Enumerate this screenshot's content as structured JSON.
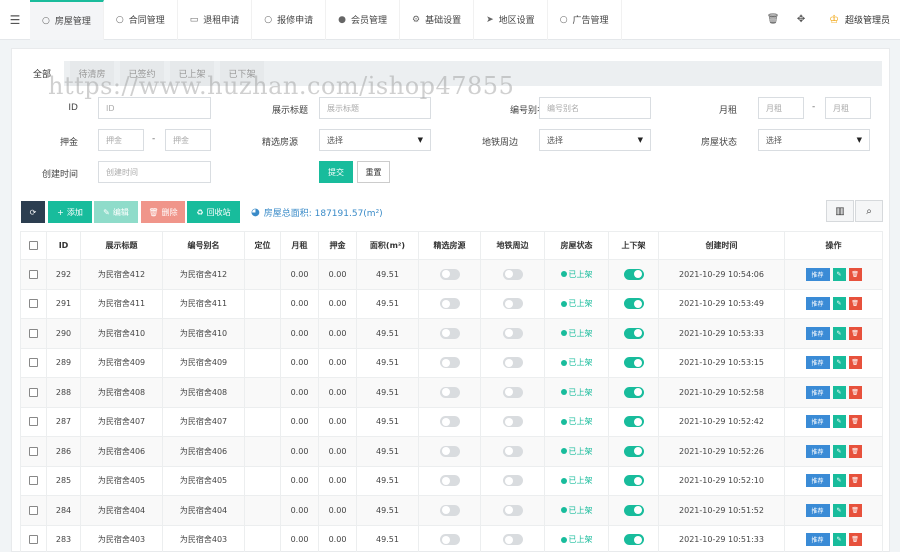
{
  "nav": {
    "menu_icon": "hamburger-icon",
    "tabs": [
      {
        "label": "房屋管理",
        "icon": "circle-icon",
        "active": true
      },
      {
        "label": "合同管理",
        "icon": "circle-icon"
      },
      {
        "label": "退租申请",
        "icon": "credit-card-icon"
      },
      {
        "label": "报修申请",
        "icon": "circle-icon"
      },
      {
        "label": "会员管理",
        "icon": "user-icon"
      },
      {
        "label": "基础设置",
        "icon": "gear-icon"
      },
      {
        "label": "地区设置",
        "icon": "send-icon"
      },
      {
        "label": "广告管理",
        "icon": "circle-icon"
      }
    ],
    "admin_name": "超级管理员"
  },
  "subtabs": [
    "全部",
    "待清房",
    "已签约",
    "已上架",
    "已下架"
  ],
  "form": {
    "id_label": "ID",
    "id_placeholder": "ID",
    "title_label": "展示标题",
    "title_placeholder": "展示标题",
    "alias_label": "编号别名",
    "alias_placeholder": "编号别名",
    "rent_label": "月租",
    "rent_min_placeholder": "月租",
    "rent_max_placeholder": "月租",
    "deposit_label": "押金",
    "deposit_min_placeholder": "押金",
    "deposit_max_placeholder": "押金",
    "featured_label": "精选房源",
    "featured_value": "选择",
    "subway_label": "地铁周边",
    "subway_value": "选择",
    "status_label": "房屋状态",
    "status_value": "选择",
    "created_label": "创建时间",
    "created_placeholder": "创建时间",
    "range_dash": "-",
    "submit": "提交",
    "reset": "重置"
  },
  "toolbar": {
    "add": "添加",
    "edit": "编辑",
    "delete": "删除",
    "recycle": "回收站",
    "area_text": "房屋总面积: 187191.57(m²)"
  },
  "table": {
    "headers": [
      "ID",
      "展示标题",
      "编号别名",
      "定位",
      "月租",
      "押金",
      "面积(m²)",
      "精选房源",
      "地铁周边",
      "房屋状态",
      "上下架",
      "创建时间",
      "操作"
    ],
    "rows": [
      {
        "id": "292",
        "title": "为民宿舍412",
        "alias": "为民宿舍412",
        "loc": "",
        "rent": "0.00",
        "deposit": "0.00",
        "area": "49.51",
        "status": "已上架",
        "created": "2021-10-29 10:54:06"
      },
      {
        "id": "291",
        "title": "为民宿舍411",
        "alias": "为民宿舍411",
        "loc": "",
        "rent": "0.00",
        "deposit": "0.00",
        "area": "49.51",
        "status": "已上架",
        "created": "2021-10-29 10:53:49"
      },
      {
        "id": "290",
        "title": "为民宿舍410",
        "alias": "为民宿舍410",
        "loc": "",
        "rent": "0.00",
        "deposit": "0.00",
        "area": "49.51",
        "status": "已上架",
        "created": "2021-10-29 10:53:33"
      },
      {
        "id": "289",
        "title": "为民宿舍409",
        "alias": "为民宿舍409",
        "loc": "",
        "rent": "0.00",
        "deposit": "0.00",
        "area": "49.51",
        "status": "已上架",
        "created": "2021-10-29 10:53:15"
      },
      {
        "id": "288",
        "title": "为民宿舍408",
        "alias": "为民宿舍408",
        "loc": "",
        "rent": "0.00",
        "deposit": "0.00",
        "area": "49.51",
        "status": "已上架",
        "created": "2021-10-29 10:52:58"
      },
      {
        "id": "287",
        "title": "为民宿舍407",
        "alias": "为民宿舍407",
        "loc": "",
        "rent": "0.00",
        "deposit": "0.00",
        "area": "49.51",
        "status": "已上架",
        "created": "2021-10-29 10:52:42"
      },
      {
        "id": "286",
        "title": "为民宿舍406",
        "alias": "为民宿舍406",
        "loc": "",
        "rent": "0.00",
        "deposit": "0.00",
        "area": "49.51",
        "status": "已上架",
        "created": "2021-10-29 10:52:26"
      },
      {
        "id": "285",
        "title": "为民宿舍405",
        "alias": "为民宿舍405",
        "loc": "",
        "rent": "0.00",
        "deposit": "0.00",
        "area": "49.51",
        "status": "已上架",
        "created": "2021-10-29 10:52:10"
      },
      {
        "id": "284",
        "title": "为民宿舍404",
        "alias": "为民宿舍404",
        "loc": "",
        "rent": "0.00",
        "deposit": "0.00",
        "area": "49.51",
        "status": "已上架",
        "created": "2021-10-29 10:51:52"
      },
      {
        "id": "283",
        "title": "为民宿舍403",
        "alias": "为民宿舍403",
        "loc": "",
        "rent": "0.00",
        "deposit": "0.00",
        "area": "49.51",
        "status": "已上架",
        "created": "2021-10-29 10:51:33"
      }
    ],
    "promo_label": "推荐"
  },
  "watermark": "https://www.huzhan.com/ishop47855",
  "colors": {
    "accent": "#18bc9c",
    "primary": "#3a8bd6",
    "danger": "#e7513c",
    "dark": "#2c3e50"
  }
}
